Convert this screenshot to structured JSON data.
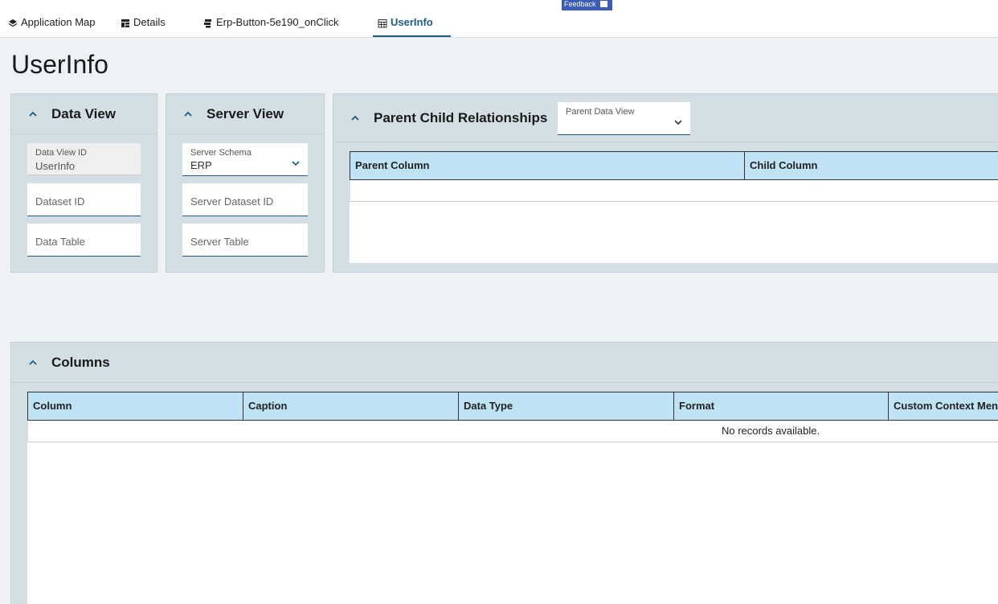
{
  "tabs": [
    {
      "label": "Application Map",
      "icon": "layers-icon"
    },
    {
      "label": "Details",
      "icon": "table-icon"
    },
    {
      "label": "Erp-Button-5e190_onClick",
      "icon": "script-icon"
    },
    {
      "label": "UserInfo",
      "icon": "grid-icon",
      "active": true
    }
  ],
  "feedback": {
    "label": "Feedback"
  },
  "page": {
    "title": "UserInfo"
  },
  "data_view": {
    "title": "Data View",
    "id_label": "Data View ID",
    "id_value": "UserInfo",
    "dataset_placeholder": "Dataset ID",
    "table_placeholder": "Data Table"
  },
  "server_view": {
    "title": "Server View",
    "schema_label": "Server Schema",
    "schema_value": "ERP",
    "dataset_placeholder": "Server Dataset ID",
    "table_placeholder": "Server Table"
  },
  "relationships": {
    "title": "Parent Child Relationships",
    "parent_dv_label": "Parent Data View",
    "columns": [
      "Parent Column",
      "Child Column"
    ]
  },
  "columns_panel": {
    "title": "Columns",
    "columns": [
      "Column",
      "Caption",
      "Data Type",
      "Format",
      "Custom Context Menu"
    ],
    "empty_text": "No records available."
  },
  "colors": {
    "accent": "#1d5a86",
    "header_bg": "#bfe3f5",
    "panel_bg": "#d3dfe4",
    "feedback": "#3b5bb5"
  }
}
